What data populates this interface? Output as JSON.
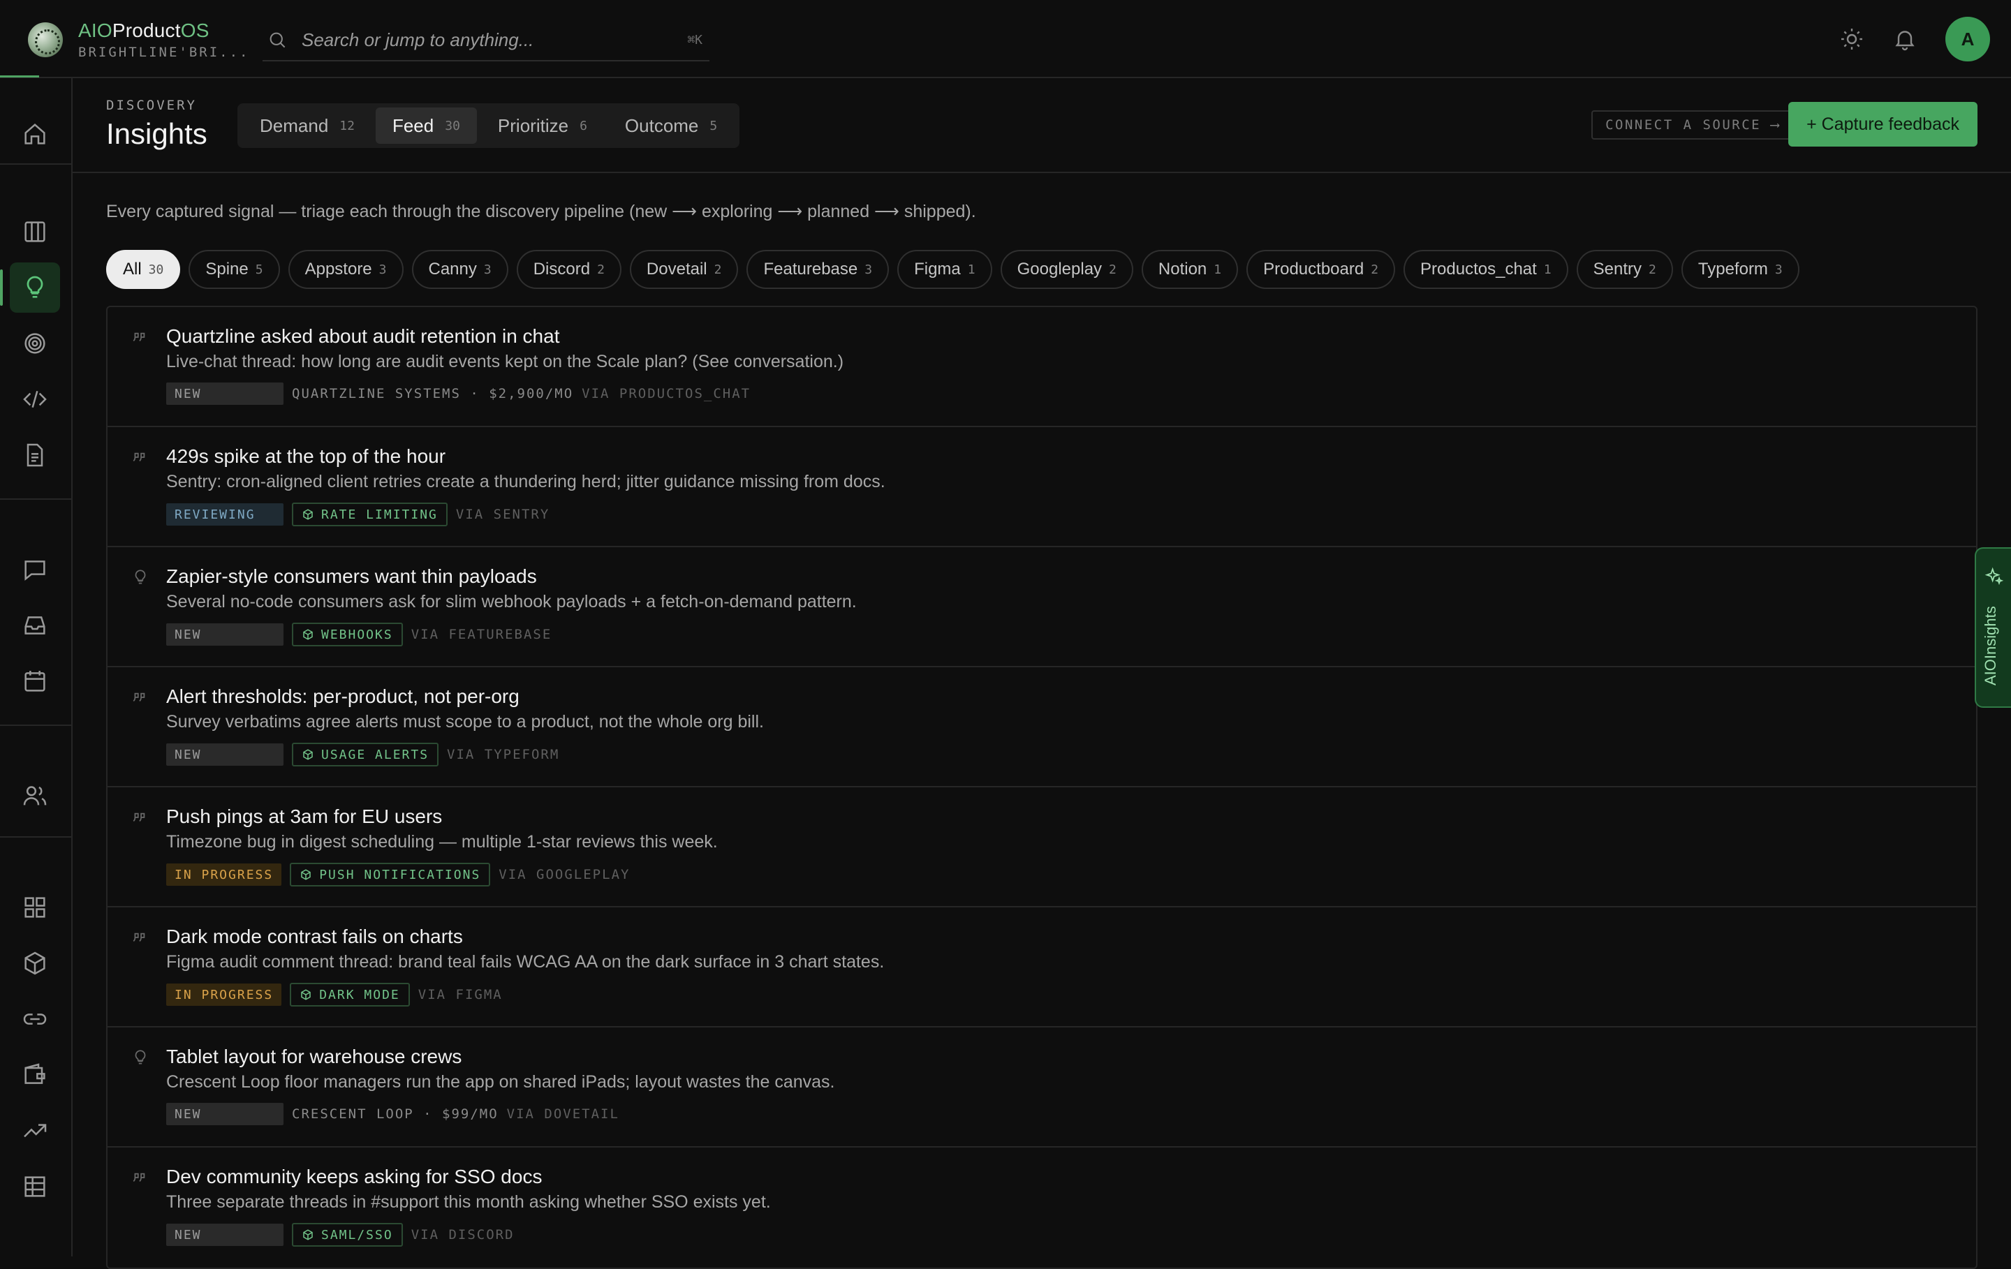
{
  "brand": {
    "prefix": "AIO",
    "name": "Product",
    "suffix": "OS",
    "workspace": "BRIGHTLINE'BRI..."
  },
  "search": {
    "placeholder": "Search or jump to anything...",
    "shortcut": "⌘K"
  },
  "user": {
    "avatar_initial": "A"
  },
  "header": {
    "eyebrow": "DISCOVERY",
    "title": "Insights",
    "tabs": [
      {
        "label": "Demand",
        "count": "12"
      },
      {
        "label": "Feed",
        "count": "30"
      },
      {
        "label": "Prioritize",
        "count": "6"
      },
      {
        "label": "Outcome",
        "count": "5"
      }
    ],
    "connect_label": "CONNECT A SOURCE ⟶",
    "capture_label": "+ Capture feedback"
  },
  "description": "Every captured signal — triage each through the discovery pipeline (new ⟶ exploring ⟶ planned ⟶ shipped).",
  "filters": [
    {
      "label": "All",
      "count": "30"
    },
    {
      "label": "Spine",
      "count": "5"
    },
    {
      "label": "Appstore",
      "count": "3"
    },
    {
      "label": "Canny",
      "count": "3"
    },
    {
      "label": "Discord",
      "count": "2"
    },
    {
      "label": "Dovetail",
      "count": "2"
    },
    {
      "label": "Featurebase",
      "count": "3"
    },
    {
      "label": "Figma",
      "count": "1"
    },
    {
      "label": "Googleplay",
      "count": "2"
    },
    {
      "label": "Notion",
      "count": "1"
    },
    {
      "label": "Productboard",
      "count": "2"
    },
    {
      "label": "Productos_chat",
      "count": "1"
    },
    {
      "label": "Sentry",
      "count": "2"
    },
    {
      "label": "Typeform",
      "count": "3"
    }
  ],
  "insights": [
    {
      "icon": "quote-icon",
      "title": "Quartzline asked about audit retention in chat",
      "desc": "Live-chat thread: how long are audit events kept on the Scale plan? (See conversation.)",
      "status": "NEW",
      "tag": "",
      "account": "QUARTZLINE SYSTEMS · $2,900/MO",
      "via": "VIA PRODUCTOS_CHAT"
    },
    {
      "icon": "quote-icon",
      "title": "429s spike at the top of the hour",
      "desc": "Sentry: cron-aligned client retries create a thundering herd; jitter guidance missing from docs.",
      "status": "REVIEWING",
      "tag": "RATE LIMITING",
      "account": "",
      "via": "VIA SENTRY"
    },
    {
      "icon": "lightbulb-icon",
      "title": "Zapier-style consumers want thin payloads",
      "desc": "Several no-code consumers ask for slim webhook payloads + a fetch-on-demand pattern.",
      "status": "NEW",
      "tag": "WEBHOOKS",
      "account": "",
      "via": "VIA FEATUREBASE"
    },
    {
      "icon": "quote-icon",
      "title": "Alert thresholds: per-product, not per-org",
      "desc": "Survey verbatims agree alerts must scope to a product, not the whole org bill.",
      "status": "NEW",
      "tag": "USAGE ALERTS",
      "account": "",
      "via": "VIA TYPEFORM"
    },
    {
      "icon": "quote-icon",
      "title": "Push pings at 3am for EU users",
      "desc": "Timezone bug in digest scheduling — multiple 1-star reviews this week.",
      "status": "IN PROGRESS",
      "tag": "PUSH NOTIFICATIONS",
      "account": "",
      "via": "VIA GOOGLEPLAY"
    },
    {
      "icon": "quote-icon",
      "title": "Dark mode contrast fails on charts",
      "desc": "Figma audit comment thread: brand teal fails WCAG AA on the dark surface in 3 chart states.",
      "status": "IN PROGRESS",
      "tag": "DARK MODE",
      "account": "",
      "via": "VIA FIGMA"
    },
    {
      "icon": "lightbulb-icon",
      "title": "Tablet layout for warehouse crews",
      "desc": "Crescent Loop floor managers run the app on shared iPads; layout wastes the canvas.",
      "status": "NEW",
      "tag": "",
      "account": "CRESCENT LOOP · $99/MO",
      "via": "VIA DOVETAIL"
    },
    {
      "icon": "quote-icon",
      "title": "Dev community keeps asking for SSO docs",
      "desc": "Three separate threads in #support this month asking whether SSO exists yet.",
      "status": "NEW",
      "tag": "SAML/SSO",
      "account": "",
      "via": "VIA DISCORD"
    }
  ],
  "side_tab": {
    "label": "AIOInsights"
  },
  "colors": {
    "accent": "#47a660",
    "background": "#0e0e0e",
    "in_progress": "#d9a24a",
    "reviewing": "#7fa9c4"
  }
}
